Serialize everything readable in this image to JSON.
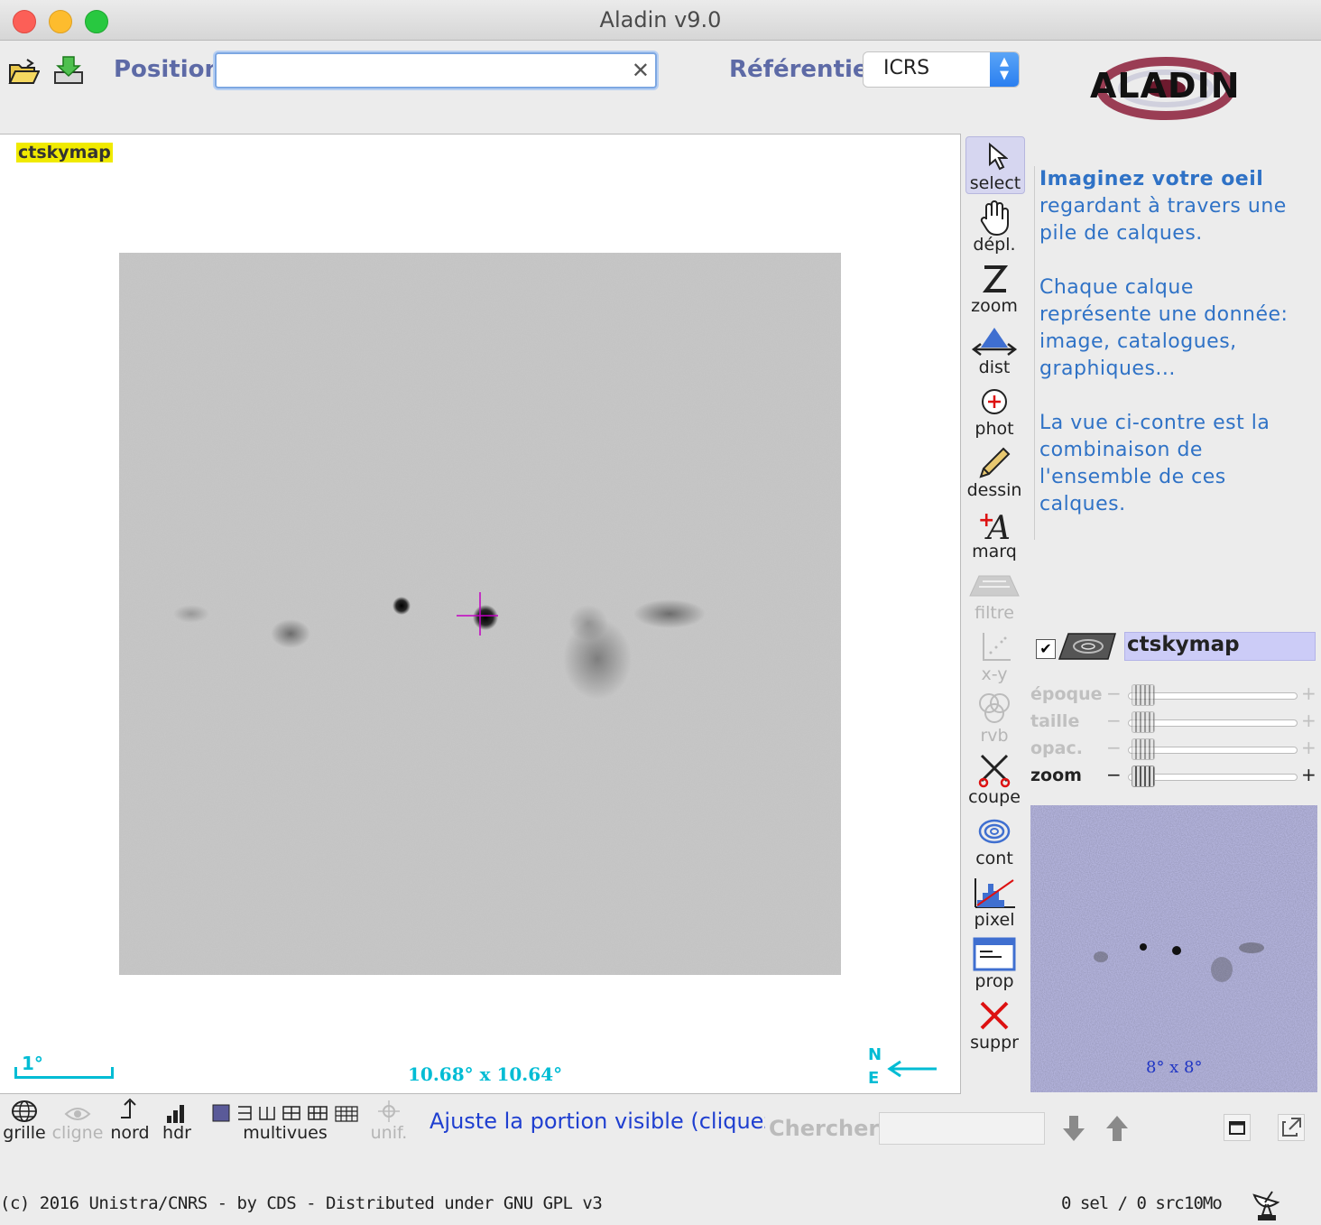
{
  "window": {
    "title": "Aladin v9.0"
  },
  "toolbar": {
    "position_label": "Position",
    "position_value": "",
    "referentiel_label": "Référentiel",
    "referentiel_value": "ICRS"
  },
  "view": {
    "label": "ctskymap",
    "scale": "1°",
    "fov": "10.68° x 10.64°",
    "compass_n": "N",
    "compass_e": "E"
  },
  "tools": [
    {
      "label": "select",
      "icon": "cursor-icon",
      "enabled": true,
      "active": true
    },
    {
      "label": "dépl.",
      "icon": "hand-icon",
      "enabled": true
    },
    {
      "label": "zoom",
      "icon": "zoom-z-icon",
      "enabled": true
    },
    {
      "label": "dist",
      "icon": "dist-arrows-icon",
      "enabled": true
    },
    {
      "label": "phot",
      "icon": "photometry-icon",
      "enabled": true
    },
    {
      "label": "dessin",
      "icon": "pencil-icon",
      "enabled": true
    },
    {
      "label": "marq",
      "icon": "marker-a-icon",
      "enabled": true
    },
    {
      "label": "filtre",
      "icon": "filter-icon",
      "enabled": false
    },
    {
      "label": "x-y",
      "icon": "scatter-plot-icon",
      "enabled": false
    },
    {
      "label": "rvb",
      "icon": "rgb-circles-icon",
      "enabled": false
    },
    {
      "label": "coupe",
      "icon": "scissors-icon",
      "enabled": true
    },
    {
      "label": "cont",
      "icon": "contour-icon",
      "enabled": true
    },
    {
      "label": "pixel",
      "icon": "histogram-icon",
      "enabled": true
    },
    {
      "label": "prop",
      "icon": "properties-icon",
      "enabled": true
    },
    {
      "label": "suppr",
      "icon": "delete-x-icon",
      "enabled": true
    }
  ],
  "help": {
    "p1_bold": "Imaginez votre oeil",
    "p1_rest": "regardant à travers une pile de calques.",
    "p2": "Chaque calque représente une donnée: image, catalogues, graphiques...",
    "p3": "La vue ci-contre est la combinaison de l'ensemble de ces calques."
  },
  "layer": {
    "name": "ctskymap",
    "checked": "✔"
  },
  "sliders": [
    {
      "name": "époque",
      "enabled": false
    },
    {
      "name": "taille",
      "enabled": false
    },
    {
      "name": "opac.",
      "enabled": false
    },
    {
      "name": "zoom",
      "enabled": true
    }
  ],
  "preview": {
    "label": "8° x 8°"
  },
  "bottom": {
    "grille": "grille",
    "cligne": "cligne",
    "nord": "nord",
    "hdr": "hdr",
    "multivues": "multivues",
    "unif": "unif.",
    "status": "Ajuste la portion visible (cliquez",
    "search_label": "Chercher",
    "search_value": ""
  },
  "footer": {
    "copyright": "(c) 2016 Unistra/CNRS - by CDS - Distributed under GNU GPL v3",
    "selection": "0 sel / 0 src",
    "memory": "10Mo"
  },
  "colors": {
    "accent": "#2f72c6",
    "label": "#5d6aa6",
    "overlay": "#00bcd4",
    "layer_highlight": "#ccccf7"
  }
}
